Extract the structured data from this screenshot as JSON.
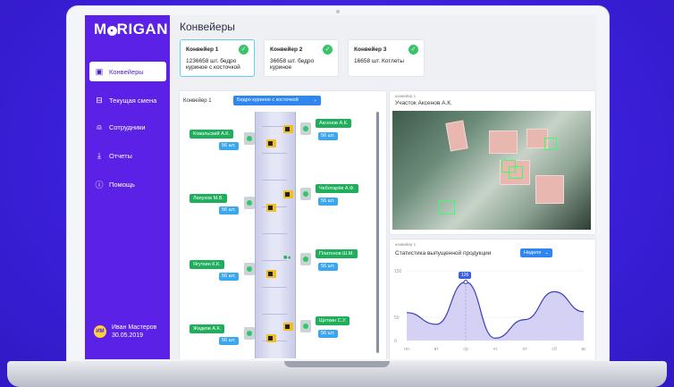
{
  "app": {
    "logo": "MORIGAN"
  },
  "sidebar": {
    "items": [
      {
        "label": "Конвейеры",
        "icon": "conveyor-icon",
        "active": true
      },
      {
        "label": "Текущая смена",
        "icon": "shift-icon",
        "active": false
      },
      {
        "label": "Сотрудники",
        "icon": "user-icon",
        "active": false
      },
      {
        "label": "Отчеты",
        "icon": "download-icon",
        "active": false
      },
      {
        "label": "Помощь",
        "icon": "help-icon",
        "active": false
      }
    ],
    "user": {
      "initials": "ИМ",
      "name": "Иван Мастеров",
      "date": "30.05.2019"
    }
  },
  "header": {
    "title": "Конвейеры"
  },
  "conveyors": [
    {
      "title": "Конвейер 1",
      "detail": "1236658 шт. бедро куриное с косточкой",
      "selected": true
    },
    {
      "title": "Конвейер 2",
      "detail": "36658 шт. бедро куриное",
      "selected": false
    },
    {
      "title": "Конвейер 3",
      "detail": "16658 шт. Котлеты",
      "selected": false
    }
  ],
  "line_panel": {
    "label": "Конвейер 1",
    "product_select": "Бедро куриное с косточкой",
    "left_workers": [
      {
        "name": "Ковальский А.К.",
        "count": "56 шт."
      },
      {
        "name": "Лапухов М.В.",
        "count": "56 шт."
      },
      {
        "name": "Ягуткин К.К.",
        "count": "56 шт."
      },
      {
        "name": "Жидков А.К.",
        "count": "56 шт."
      }
    ],
    "right_workers": [
      {
        "name": "Аксенов А.К.",
        "count": "56 шт."
      },
      {
        "name": "Чеботарёв А.Ф.",
        "count": "56 шт."
      },
      {
        "name": "Платонов Ш.М.",
        "count": "56 шт."
      },
      {
        "name": "Щеткин С.У.",
        "count": "56 шт."
      }
    ]
  },
  "camera_panel": {
    "small": "конвейер 1",
    "title": "Участок Аксенов А.К."
  },
  "stats_panel": {
    "small": "конвейер 1",
    "title": "Статистика выпущенной продукции",
    "period_select": "Неделя",
    "tooltip_value": "126"
  },
  "chart_data": {
    "type": "area",
    "categories": [
      "пн",
      "вт",
      "ср",
      "чт",
      "пт",
      "сб",
      "вс"
    ],
    "values": [
      60,
      35,
      126,
      5,
      45,
      105,
      62
    ],
    "ylim": [
      0,
      150
    ],
    "yticks": [
      "150",
      "50",
      "0"
    ],
    "grid": true,
    "colors": {
      "line": "#3a3fb8",
      "fill": "#c9c6f2"
    }
  }
}
